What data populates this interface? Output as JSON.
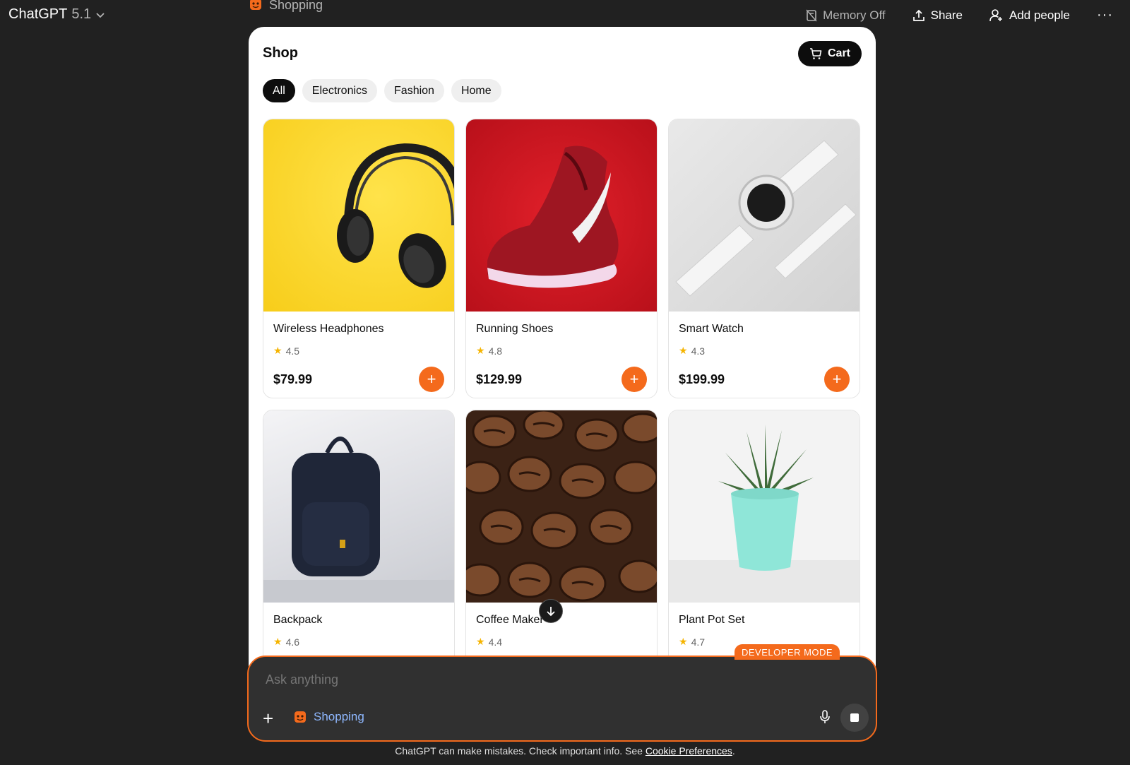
{
  "topbar": {
    "model_name": "ChatGPT",
    "model_version": "5.1",
    "app_tab": "Shopping",
    "memory_label": "Memory Off",
    "share_label": "Share",
    "add_people_label": "Add people",
    "more_label": "···"
  },
  "shop": {
    "title": "Shop",
    "cart_label": "Cart",
    "filters": [
      "All",
      "Electronics",
      "Fashion",
      "Home"
    ],
    "active_filter": "All",
    "products": [
      {
        "name": "Wireless Headphones",
        "rating": "4.5",
        "price": "$79.99",
        "icon": "headphones"
      },
      {
        "name": "Running Shoes",
        "rating": "4.8",
        "price": "$129.99",
        "icon": "sneaker"
      },
      {
        "name": "Smart Watch",
        "rating": "4.3",
        "price": "$199.99",
        "icon": "smartwatch"
      },
      {
        "name": "Backpack",
        "rating": "4.6",
        "price": "",
        "icon": "backpack"
      },
      {
        "name": "Coffee Maker",
        "rating": "4.4",
        "price": "",
        "icon": "coffee-beans"
      },
      {
        "name": "Plant Pot Set",
        "rating": "4.7",
        "price": "",
        "icon": "potted-plant"
      }
    ]
  },
  "dev_badge": "DEVELOPER MODE",
  "composer": {
    "placeholder": "Ask anything",
    "app_name": "Shopping"
  },
  "footer": {
    "text": "ChatGPT can make mistakes. Check important info. See ",
    "link": "Cookie Preferences",
    "suffix": "."
  },
  "colors": {
    "background": "#212121",
    "accent": "#f46a1c",
    "star": "#f5b400"
  }
}
